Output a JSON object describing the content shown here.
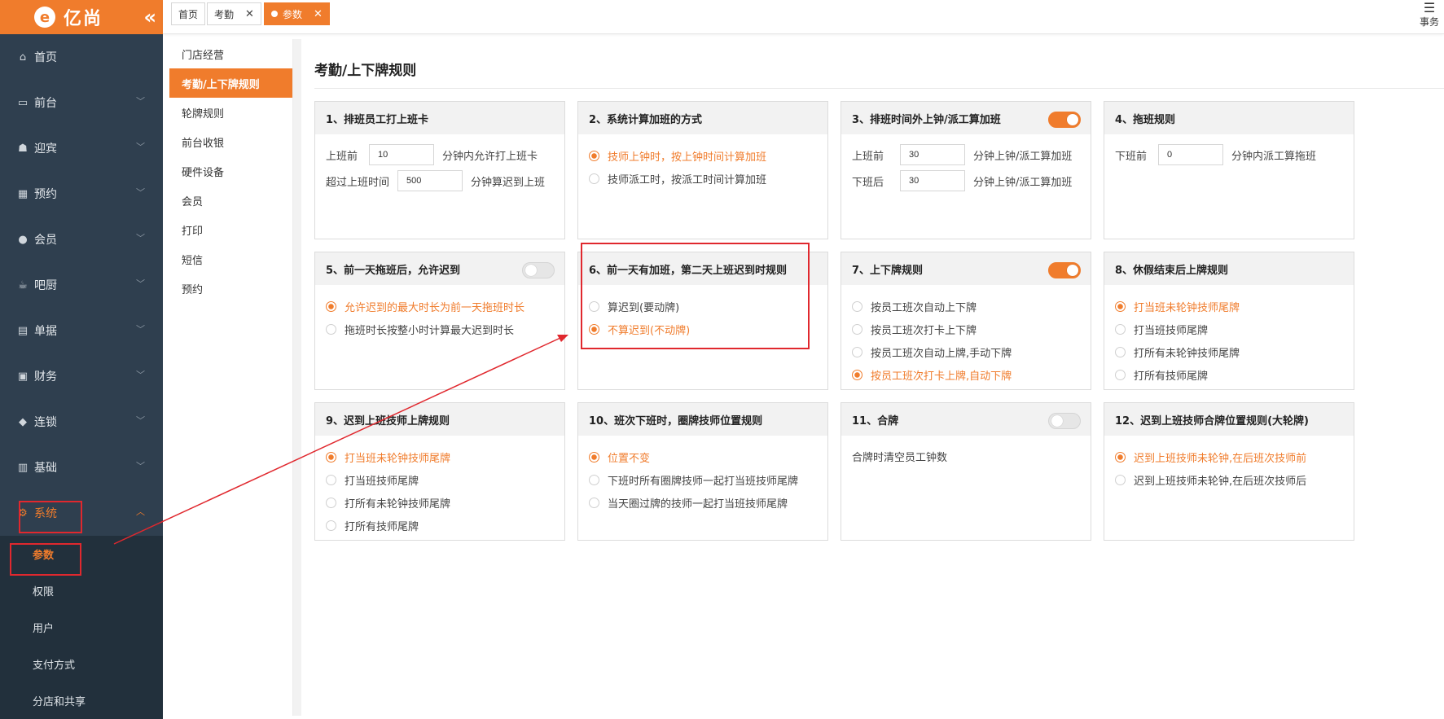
{
  "brand": {
    "name": "亿尚",
    "logo_letter": "e",
    "collapse_glyph": "«",
    "accent": "#f07c2c"
  },
  "nav": [
    {
      "label": "首页",
      "icon": "home-icon",
      "glyph": "⌂",
      "chevron": false
    },
    {
      "label": "前台",
      "icon": "monitor-icon",
      "glyph": "▭",
      "chevron": true
    },
    {
      "label": "迎宾",
      "icon": "reception-icon",
      "glyph": "☗",
      "chevron": true
    },
    {
      "label": "预约",
      "icon": "calendar-icon",
      "glyph": "▦",
      "chevron": true
    },
    {
      "label": "会员",
      "icon": "user-icon",
      "glyph": "●",
      "chevron": true
    },
    {
      "label": "吧厨",
      "icon": "cup-icon",
      "glyph": "☕",
      "chevron": true
    },
    {
      "label": "单据",
      "icon": "clipboard-icon",
      "glyph": "▤",
      "chevron": true
    },
    {
      "label": "财务",
      "icon": "finance-icon",
      "glyph": "▣",
      "chevron": true
    },
    {
      "label": "连锁",
      "icon": "cube-icon",
      "glyph": "◆",
      "chevron": true
    },
    {
      "label": "基础",
      "icon": "database-icon",
      "glyph": "▥",
      "chevron": true
    },
    {
      "label": "系统",
      "icon": "gear-icon",
      "glyph": "⚙",
      "chevron": true
    }
  ],
  "subnav": [
    "参数",
    "权限",
    "用户",
    "支付方式",
    "分店和共享"
  ],
  "tabs": [
    {
      "label": "首页"
    },
    {
      "label": "考勤"
    },
    {
      "label": "参数"
    }
  ],
  "menu_label": "事务",
  "submenu": [
    "门店经营",
    "考勤/上下牌规则",
    "轮牌规则",
    "前台收银",
    "硬件设备",
    "会员",
    "打印",
    "短信",
    "预约"
  ],
  "page_title": "考勤/上下牌规则",
  "cards": {
    "c1": {
      "title": "1、排班员工打上班卡",
      "rows": [
        {
          "before": "上班前",
          "value": "10",
          "after": "分钟内允许打上班卡"
        },
        {
          "before": "超过上班时间",
          "value": "500",
          "after": "分钟算迟到上班"
        }
      ]
    },
    "c2": {
      "title": "2、系统计算加班的方式",
      "options": [
        "技师上钟时，按上钟时间计算加班",
        "技师派工时，按派工时间计算加班"
      ]
    },
    "c3": {
      "title": "3、排班时间外上钟/派工算加班",
      "rows": [
        {
          "before": "上班前",
          "value": "30",
          "after": "分钟上钟/派工算加班"
        },
        {
          "before": "下班后",
          "value": "30",
          "after": "分钟上钟/派工算加班"
        }
      ]
    },
    "c4": {
      "title": "4、拖班规则",
      "rows": [
        {
          "before": "下班前",
          "value": "0",
          "after": "分钟内派工算拖班"
        }
      ]
    },
    "c5": {
      "title": "5、前一天拖班后，允许迟到",
      "options": [
        "允许迟到的最大时长为前一天拖班时长",
        "拖班时长按整小时计算最大迟到时长"
      ]
    },
    "c6": {
      "title": "6、前一天有加班，第二天上班迟到时规则",
      "options": [
        "算迟到(要动牌)",
        "不算迟到(不动牌)"
      ]
    },
    "c7": {
      "title": "7、上下牌规则",
      "options": [
        "按员工班次自动上下牌",
        "按员工班次打卡上下牌",
        "按员工班次自动上牌,手动下牌",
        "按员工班次打卡上牌,自动下牌"
      ]
    },
    "c8": {
      "title": "8、休假结束后上牌规则",
      "options": [
        "打当班未轮钟技师尾牌",
        "打当班技师尾牌",
        "打所有未轮钟技师尾牌",
        "打所有技师尾牌"
      ]
    },
    "c9": {
      "title": "9、迟到上班技师上牌规则",
      "options": [
        "打当班未轮钟技师尾牌",
        "打当班技师尾牌",
        "打所有未轮钟技师尾牌",
        "打所有技师尾牌"
      ]
    },
    "c10": {
      "title": "10、班次下班时，圈牌技师位置规则",
      "options": [
        "位置不变",
        "下班时所有圈牌技师一起打当班技师尾牌",
        "当天圈过牌的技师一起打当班技师尾牌"
      ]
    },
    "c11": {
      "title": "11、合牌",
      "text": "合牌时清空员工钟数"
    },
    "c12": {
      "title": "12、迟到上班技师合牌位置规则(大轮牌)",
      "options": [
        "迟到上班技师未轮钟,在后班次技师前",
        "迟到上班技师未轮钟,在后班次技师后"
      ]
    }
  },
  "colors": {
    "sidebar": "#2f3f4f",
    "subnav": "#22303c",
    "highlight_box": "#e0282e"
  }
}
